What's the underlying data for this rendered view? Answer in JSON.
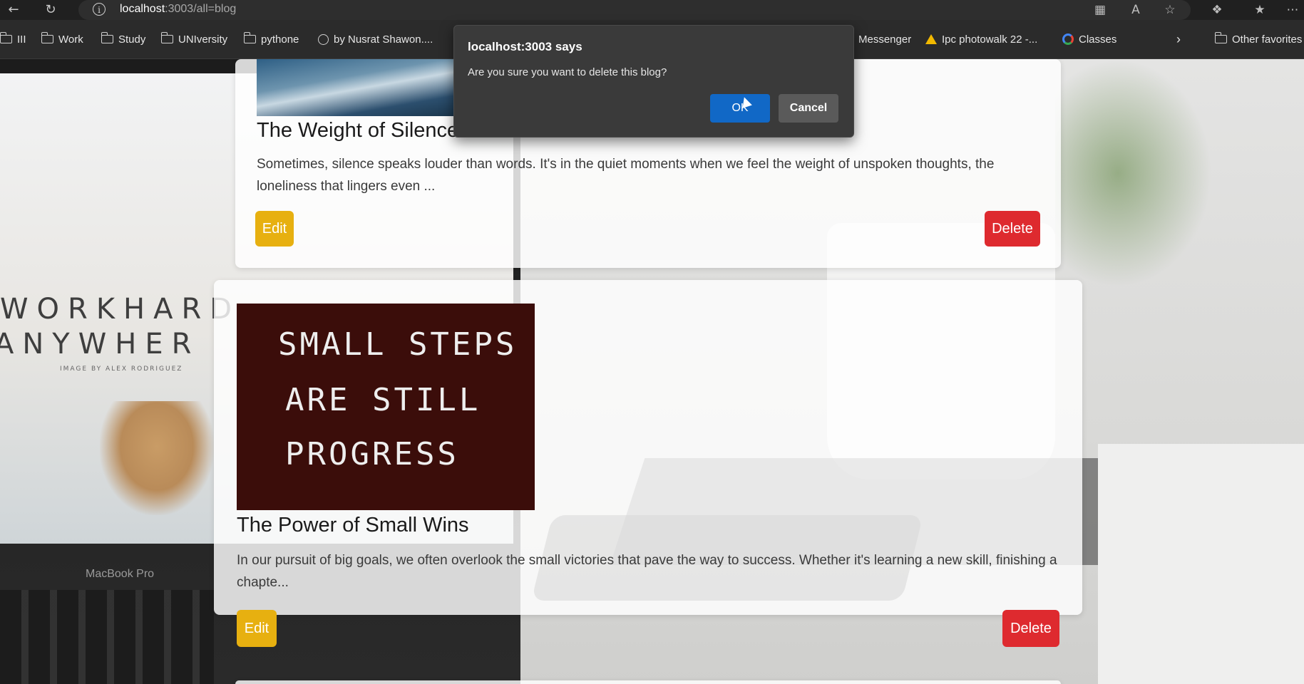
{
  "browser": {
    "address": {
      "host": "localhost",
      "rest": ":3003/all=blog"
    },
    "icons": [
      "back-icon",
      "refresh-icon",
      "info-icon",
      "app-available-icon",
      "read-aloud-icon",
      "favorite-star-icon",
      "extensions-icon",
      "favorites-icon",
      "more-icon"
    ]
  },
  "bookmarks": {
    "apps_label": "III",
    "items": [
      {
        "label": "Work"
      },
      {
        "label": "Study"
      },
      {
        "label": "UNIversity"
      },
      {
        "label": "pythone"
      },
      {
        "label": "by Nusrat Shawon...."
      },
      {
        "label": "Messenger"
      },
      {
        "label": "Ipc photowalk 22 -..."
      },
      {
        "label": "Classes"
      },
      {
        "label": "Other favorites"
      }
    ]
  },
  "background": {
    "laptop_line1": "WORKHARD",
    "laptop_line2": "ANYWHER",
    "laptop_credit": "IMAGE BY ALEX RODRIGUEZ",
    "laptop_model": "MacBook Pro"
  },
  "blogs": [
    {
      "title": "The Weight of Silence",
      "excerpt": "Sometimes, silence speaks louder than words. It's in the quiet moments when we feel the weight of unspoken thoughts, the loneliness that lingers even ...",
      "edit_label": "Edit",
      "delete_label": "Delete"
    },
    {
      "image_text": [
        "SMALL STEPS",
        "ARE STILL",
        "PROGRESS"
      ],
      "title": "The Power of Small Wins",
      "excerpt": "In our pursuit of big goals, we often overlook the small victories that pave the way to success. Whether it's learning a new skill, finishing a chapte...",
      "edit_label": "Edit",
      "delete_label": "Delete"
    }
  ],
  "dialog": {
    "title": "localhost:3003 says",
    "message": "Are you sure you want to delete this blog?",
    "ok_label": "OK",
    "cancel_label": "Cancel"
  },
  "colors": {
    "edit": "#e7b010",
    "delete": "#de2a2f",
    "ok": "#1168c6",
    "dialog_bg": "#3a3a3a"
  }
}
